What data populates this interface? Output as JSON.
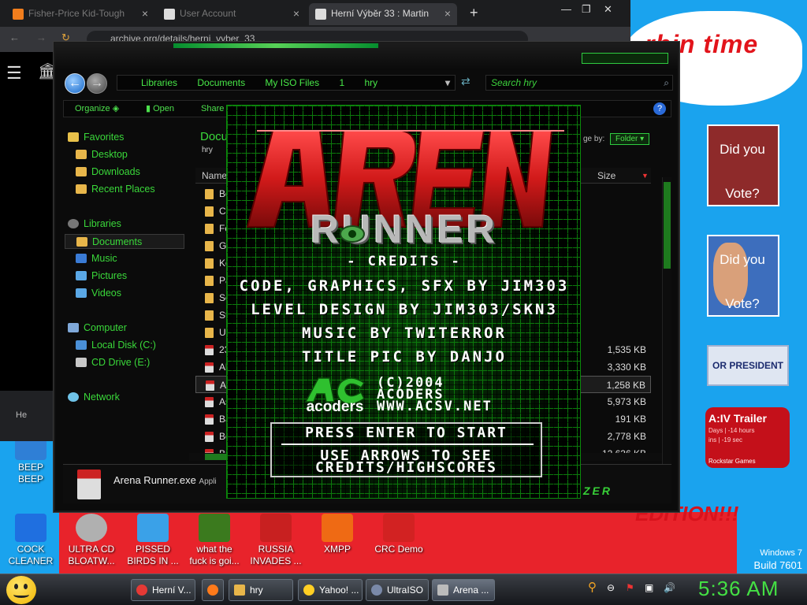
{
  "desktop": {
    "cloud_text": "rbin time",
    "card1": {
      "line1": "Did you",
      "line2": "Vote?"
    },
    "card2": {
      "line1": "Did you",
      "line2": "Vote?"
    },
    "president_banner": "OR PRESIDENT",
    "gta": {
      "title": "A:IV Trailer",
      "days": "Days | -14 hours",
      "mins": "ins | -19 sec",
      "publisher": "Rockstar Games"
    },
    "edition": "L\nEDITION!!!",
    "windows_label": "Windows 7",
    "build_label": "Build 7601",
    "icons": [
      {
        "label": "BEEP\nBEEP",
        "color": "#2f7fd6"
      },
      {
        "label": "COCK\nCLEANER",
        "color": "#1f6fe0"
      },
      {
        "label": "ULTRA CD\nBLOATW...",
        "color": "#b0b0b0"
      },
      {
        "label": "PISSED\nBIRDS IN ...",
        "color": "#3aa1e8"
      },
      {
        "label": "what the\nfuck is goi...",
        "color": "#3b7a1e"
      },
      {
        "label": "RUSSIA\nINVADES ...",
        "color": "#c82020"
      },
      {
        "label": "XMPP",
        "color": "#ef6a14"
      },
      {
        "label": "CRC Demo",
        "color": "#d22222"
      }
    ]
  },
  "browser": {
    "tabs": [
      {
        "label": "Fisher-Price Kid-Tough",
        "color": "#f27e1d"
      },
      {
        "label": "User Account",
        "color": "#dddddd"
      },
      {
        "label": "Herní Výběr 33 : Martin",
        "color": "#dddddd"
      }
    ],
    "url": "archive.org/details/herni_vyber_33",
    "sidebar_iso_label": "He"
  },
  "explorer": {
    "address": [
      "Libraries",
      "Documents",
      "My ISO Files",
      "1",
      "hry"
    ],
    "search_placeholder": "Search hry",
    "commands": {
      "organize": "Organize",
      "open": "Open",
      "share": "Share"
    },
    "nav": {
      "favorites": "Favorites",
      "desktop": "Desktop",
      "downloads": "Downloads",
      "recent": "Recent Places",
      "libraries": "Libraries",
      "documents": "Documents",
      "music": "Music",
      "pictures": "Pictures",
      "videos": "Videos",
      "computer": "Computer",
      "local_disk": "Local Disk (C:)",
      "cd_drive": "CD Drive (E:)",
      "network": "Network"
    },
    "content_title": "Docu",
    "content_subtitle": "hry",
    "arrange_label": "ge by:",
    "arrange_value": "Folder",
    "columns": {
      "name": "Name",
      "size": "Size"
    },
    "rows": [
      {
        "name": "Bo",
        "size": ""
      },
      {
        "name": "Co",
        "size": ""
      },
      {
        "name": "Fe",
        "size": ""
      },
      {
        "name": "Gr",
        "size": ""
      },
      {
        "name": "Ko",
        "size": ""
      },
      {
        "name": "Pa",
        "size": ""
      },
      {
        "name": "Se",
        "size": ""
      },
      {
        "name": "St",
        "size": ""
      },
      {
        "name": "Ul",
        "size": ""
      },
      {
        "name": "23",
        "size": "1,535 KB"
      },
      {
        "name": "Al",
        "size": "3,330 KB"
      },
      {
        "name": "Ar",
        "size": "1,258 KB"
      },
      {
        "name": "As",
        "size": "5,973 KB"
      },
      {
        "name": "Ba",
        "size": "191 KB"
      },
      {
        "name": "Bo",
        "size": "2,778 KB"
      },
      {
        "name": "Br",
        "size": "12,636 KB"
      }
    ],
    "details_name": "Arena Runner.exe",
    "details_type": "Appli",
    "skin_brand": "ZER"
  },
  "game": {
    "logo_top": "ARENA",
    "logo_bottom": "RUNNER",
    "credits_header": "- Credits -",
    "lines": [
      "Code, Graphics, SFX by Jim303",
      "Level Design by Jim303/Skn3",
      "Music by Twiterror",
      "Title Pic by Danjo"
    ],
    "copyright": [
      "(C)2004",
      "Acoders",
      "www.acsv.net"
    ],
    "ac_logo_word": "acoders",
    "menu": [
      "Press Enter to Start",
      "Use Arrows to See",
      "Credits/Highscores"
    ]
  },
  "taskbar": {
    "items": [
      {
        "label": "Herní V...",
        "color": "#e53935"
      },
      {
        "label": "",
        "color": "#ff7a1a"
      },
      {
        "label": "hry",
        "color": "#e8b64a"
      },
      {
        "label": "Yahoo! ...",
        "color": "#ffcf24"
      },
      {
        "label": "UltraISO",
        "color": "#7a89a8"
      },
      {
        "label": "Arena ...",
        "color": "#bbbbbb"
      }
    ],
    "clock": "5:36 AM"
  }
}
